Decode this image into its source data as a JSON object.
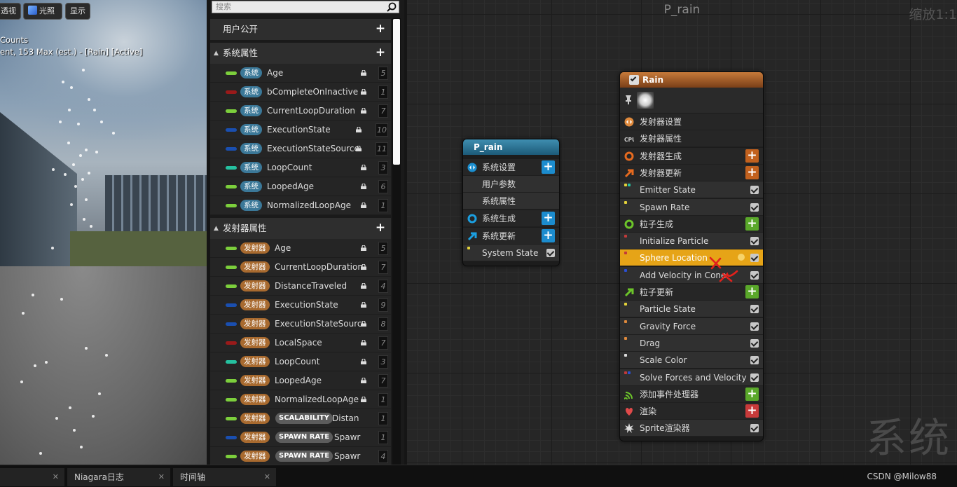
{
  "viewport": {
    "buttons": [
      "透视",
      "光照",
      "显示"
    ],
    "stats_line1": "Counts",
    "stats_line2": "ent, 153 Max (est.) - [Rain] [Active]"
  },
  "params": {
    "search_placeholder": "搜索",
    "user_public": "用户公开",
    "system_section": "系统属性",
    "emitter_section": "发射器属性",
    "system_tag": "系统",
    "emitter_tag": "发射器",
    "system_rows": [
      {
        "name": "Age",
        "num": "5",
        "color": "#7ccf3c"
      },
      {
        "name": "bCompleteOnInactive",
        "num": "1",
        "color": "#9a1a1a"
      },
      {
        "name": "CurrentLoopDuration",
        "num": "7",
        "color": "#7ccf3c"
      },
      {
        "name": "ExecutionState",
        "num": "10",
        "color": "#1a4fb0"
      },
      {
        "name": "ExecutionStateSource",
        "num": "11",
        "color": "#1a4fb0"
      },
      {
        "name": "LoopCount",
        "num": "3",
        "color": "#25c1a0"
      },
      {
        "name": "LoopedAge",
        "num": "6",
        "color": "#7ccf3c"
      },
      {
        "name": "NormalizedLoopAge",
        "num": "1",
        "color": "#7ccf3c"
      }
    ],
    "emitter_rows": [
      {
        "name": "Age",
        "num": "5",
        "color": "#7ccf3c"
      },
      {
        "name": "CurrentLoopDuration",
        "num": "7",
        "color": "#7ccf3c"
      },
      {
        "name": "DistanceTraveled",
        "num": "4",
        "color": "#7ccf3c"
      },
      {
        "name": "ExecutionState",
        "num": "9",
        "color": "#1a4fb0"
      },
      {
        "name": "ExecutionStateSource",
        "num": "8",
        "color": "#1a4fb0"
      },
      {
        "name": "LocalSpace",
        "num": "7",
        "color": "#9a1a1a"
      },
      {
        "name": "LoopCount",
        "num": "3",
        "color": "#25c1a0"
      },
      {
        "name": "LoopedAge",
        "num": "7",
        "color": "#7ccf3c"
      },
      {
        "name": "NormalizedLoopAge",
        "num": "1",
        "color": "#7ccf3c"
      },
      {
        "name": "Distan",
        "num": "1",
        "color": "#7ccf3c",
        "tag2": "SCALABILITY"
      },
      {
        "name": "Spawr",
        "num": "1",
        "color": "#1a4fb0",
        "tag2": "SPAWN RATE"
      },
      {
        "name": "Spawr",
        "num": "4",
        "color": "#7ccf3c",
        "tag2": "SPAWN RATE"
      }
    ]
  },
  "graph": {
    "title": "P_rain",
    "zoom": "缩放1:1",
    "watermark": "系统",
    "system_node": {
      "title": "P_rain",
      "rows": [
        "系统设置",
        "用户参数",
        "系统属性",
        "系统生成",
        "系统更新",
        "System State"
      ]
    },
    "emitter_node": {
      "title": "Rain",
      "rows": [
        "发射器设置",
        "发射器属性",
        "发射器生成",
        "发射器更新",
        "Emitter State",
        "Spawn Rate",
        "粒子生成",
        "Initialize Particle",
        "Sphere Location",
        "Add Velocity in Cone",
        "粒子更新",
        "Particle State",
        "Gravity Force",
        "Drag",
        "Scale Color",
        "Solve Forces and Velocity",
        "添加事件处理器",
        "渲染",
        "Sprite渲染器"
      ]
    }
  },
  "bottom": {
    "tabs": [
      "Niagara日志",
      "时间轴"
    ],
    "credit": "CSDN @Milow88"
  }
}
